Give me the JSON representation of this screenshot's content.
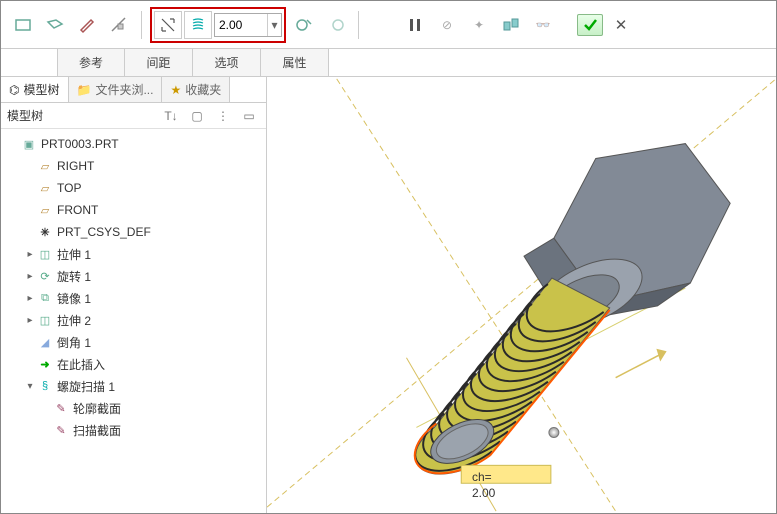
{
  "toolbar": {
    "pitch_value": "2.00"
  },
  "ribbon_tabs": [
    "参考",
    "间距",
    "选项",
    "属性"
  ],
  "side_tabs": {
    "t0": "模型树",
    "t1": "文件夹浏...",
    "t2": "收藏夹"
  },
  "tree": {
    "header": "模型树",
    "root": "PRT0003.PRT",
    "nodes": {
      "right": "RIGHT",
      "top": "TOP",
      "front": "FRONT",
      "csys": "PRT_CSYS_DEF",
      "ext1": "拉伸 1",
      "rev1": "旋转 1",
      "mir1": "镜像 1",
      "ext2": "拉伸 2",
      "cham1": "倒角 1",
      "insert": "在此插入",
      "helix": "螺旋扫描 1",
      "profile": "轮廓截面",
      "sweep": "扫描截面"
    },
    "tools": {
      "t1": "▾",
      "t2": "⊞",
      "t3": "⋮",
      "t4": "⊟"
    }
  },
  "viewport": {
    "dim_prefix": "ch= ",
    "dim_value": "2.00"
  }
}
